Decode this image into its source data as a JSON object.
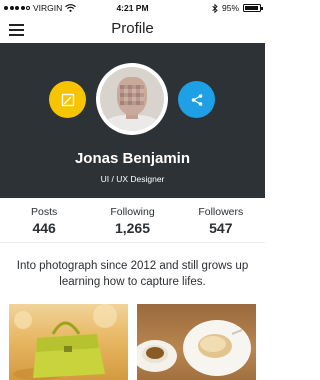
{
  "status_bar": {
    "carrier": "VIRGIN",
    "time": "4:21 PM",
    "battery": "95%",
    "battery_level": 0.95,
    "icons": [
      "signal-dots-icon",
      "wifi-icon",
      "bluetooth-icon",
      "battery-icon"
    ]
  },
  "nav": {
    "title": "Profile",
    "menu_icon": "hamburger-menu-icon"
  },
  "profile": {
    "name": "Jonas Benjamin",
    "role": "UI / UX Designer",
    "edit_icon": "edit-icon",
    "share_icon": "share-icon"
  },
  "stats": [
    {
      "label": "Posts",
      "value": "446"
    },
    {
      "label": "Following",
      "value": "1,265"
    },
    {
      "label": "Followers",
      "value": "547"
    }
  ],
  "bio": "Into photograph since 2012 and still grows up learning how to capture lifes.",
  "colors": {
    "hero_bg": "#2c3236",
    "edit_accent": "#f6c400",
    "share_accent": "#1ea0e6"
  },
  "gallery": [
    {
      "icon": "photo-handbag-thumbnail"
    },
    {
      "icon": "photo-coffee-breakfast-thumbnail"
    }
  ]
}
